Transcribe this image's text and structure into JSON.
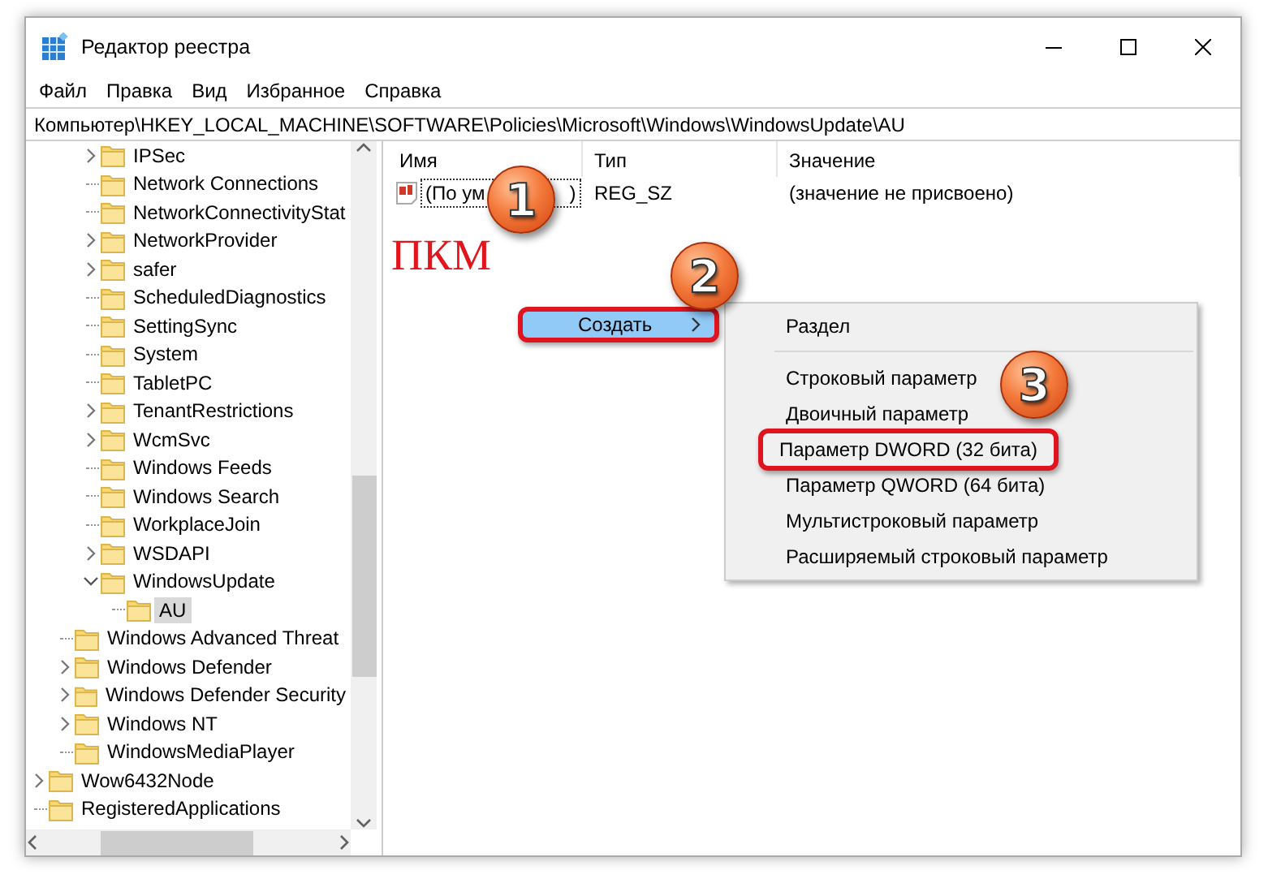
{
  "window": {
    "title": "Редактор реестра"
  },
  "menu_bar": [
    "Файл",
    "Правка",
    "Вид",
    "Избранное",
    "Справка"
  ],
  "address_bar": {
    "value": "Компьютер\\HKEY_LOCAL_MACHINE\\SOFTWARE\\Policies\\Microsoft\\Windows\\WindowsUpdate\\AU"
  },
  "tree": {
    "items": [
      {
        "children": [
          {
            "children": [
              {
                "label": "IPSec",
                "has_children": true,
                "expanded": false,
                "selected": false
              },
              {
                "label": "Network Connections",
                "has_children": false,
                "expanded": false,
                "selected": false
              },
              {
                "label": "NetworkConnectivityStat",
                "has_children": false,
                "expanded": false,
                "selected": false
              },
              {
                "label": "NetworkProvider",
                "has_children": true,
                "expanded": false,
                "selected": false
              },
              {
                "label": "safer",
                "has_children": true,
                "expanded": false,
                "selected": false
              },
              {
                "label": "ScheduledDiagnostics",
                "has_children": false,
                "expanded": false,
                "selected": false
              },
              {
                "label": "SettingSync",
                "has_children": false,
                "expanded": false,
                "selected": false
              },
              {
                "label": "System",
                "has_children": false,
                "expanded": false,
                "selected": false
              },
              {
                "label": "TabletPC",
                "has_children": false,
                "expanded": false,
                "selected": false
              },
              {
                "label": "TenantRestrictions",
                "has_children": true,
                "expanded": false,
                "selected": false
              },
              {
                "label": "WcmSvc",
                "has_children": true,
                "expanded": false,
                "selected": false
              },
              {
                "label": "Windows Feeds",
                "has_children": false,
                "expanded": false,
                "selected": false
              },
              {
                "label": "Windows Search",
                "has_children": false,
                "expanded": false,
                "selected": false
              },
              {
                "label": "WorkplaceJoin",
                "has_children": false,
                "expanded": false,
                "selected": false
              },
              {
                "label": "WSDAPI",
                "has_children": true,
                "expanded": false,
                "selected": false
              },
              {
                "label": "WindowsUpdate",
                "has_children": true,
                "expanded": true,
                "selected": false,
                "children": [
                  {
                    "label": "AU",
                    "has_children": false,
                    "expanded": false,
                    "selected": true
                  }
                ]
              }
            ]
          },
          {
            "label": "Windows Advanced Threat",
            "has_children": false,
            "expanded": false,
            "selected": false
          },
          {
            "label": "Windows Defender",
            "has_children": true,
            "expanded": false,
            "selected": false
          },
          {
            "label": "Windows Defender Security",
            "has_children": true,
            "expanded": false,
            "selected": false
          },
          {
            "label": "Windows NT",
            "has_children": true,
            "expanded": false,
            "selected": false
          },
          {
            "label": "WindowsMediaPlayer",
            "has_children": false,
            "expanded": false,
            "selected": false
          }
        ]
      },
      {
        "label": "Wow6432Node",
        "has_children": true,
        "expanded": false,
        "selected": false
      },
      {
        "label": "RegisteredApplications",
        "has_children": false,
        "expanded": false,
        "selected": false
      }
    ]
  },
  "values_list": {
    "columns": [
      "Имя",
      "Тип",
      "Значение"
    ],
    "rows": [
      {
        "name_start": "(По ум",
        "name_end": ")",
        "type": "REG_SZ",
        "data": "(значение не присвоено)",
        "focused": true
      }
    ]
  },
  "context_menu": {
    "items": [
      {
        "label": "Создать",
        "submenu": true,
        "highlighted": true,
        "outlined": true
      }
    ]
  },
  "submenu": {
    "items": [
      {
        "kind": "item",
        "label": "Раздел",
        "outlined": false
      },
      {
        "kind": "separator"
      },
      {
        "kind": "item",
        "label": "Строковый параметр",
        "outlined": false
      },
      {
        "kind": "item",
        "label": "Двоичный параметр",
        "outlined": false
      },
      {
        "kind": "item",
        "label": "Параметр DWORD (32 бита)",
        "outlined": true
      },
      {
        "kind": "item",
        "label": "Параметр QWORD (64 бита)",
        "outlined": false
      },
      {
        "kind": "item",
        "label": "Мультистроковый параметр",
        "outlined": false
      },
      {
        "kind": "item",
        "label": "Расширяемый строковый параметр",
        "outlined": false
      }
    ]
  },
  "annotations": {
    "note": "ПКМ",
    "steps": [
      "1",
      "2",
      "3"
    ]
  }
}
